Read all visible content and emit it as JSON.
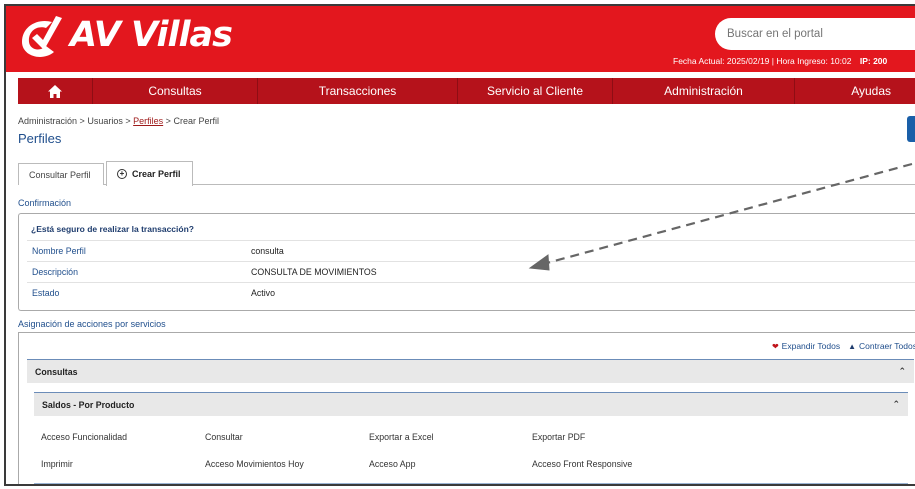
{
  "brand": {
    "name": "AV Villas"
  },
  "header": {
    "search_placeholder": "Buscar en el portal",
    "session_text": "Fecha Actual: 2025/02/19 | Hora Ingreso: 10:02",
    "ip_label": "IP: 200"
  },
  "menu": {
    "items": [
      "Consultas",
      "Transacciones",
      "Servicio al Cliente",
      "Administración",
      "Ayudas"
    ]
  },
  "breadcrumb": {
    "part1": "Administración",
    "part2": "Usuarios",
    "part3": "Perfiles",
    "part4": "Crear Perfil",
    "sep": ">"
  },
  "page": {
    "title": "Perfiles"
  },
  "tabs": {
    "consultar": "Consultar Perfil",
    "crear": "Crear Perfil"
  },
  "confirmation": {
    "section_label": "Confirmación",
    "question": "¿Está seguro de realizar la transacción?",
    "rows": [
      {
        "key": "Nombre Perfil",
        "value": "consulta"
      },
      {
        "key": "Descripción",
        "value": "CONSULTA DE MOVIMIENTOS"
      },
      {
        "key": "Estado",
        "value": "Activo"
      }
    ]
  },
  "assignment": {
    "section_label": "Asignación de acciones por servicios",
    "expand_all": "Expandir Todos",
    "collapse_all": "Contraer Todos",
    "group": "Consultas",
    "subgroup": "Saldos - Por Producto",
    "permissions": [
      "Acceso Funcionalidad",
      "Consultar",
      "Exportar a Excel",
      "Exportar PDF",
      "Imprimir",
      "Acceso Movimientos Hoy",
      "Acceso App",
      "Acceso Front Responsive"
    ]
  },
  "colors": {
    "brand_red": "#e3171e",
    "menu_red": "#b5121b",
    "link_blue": "#1f4e8c"
  }
}
